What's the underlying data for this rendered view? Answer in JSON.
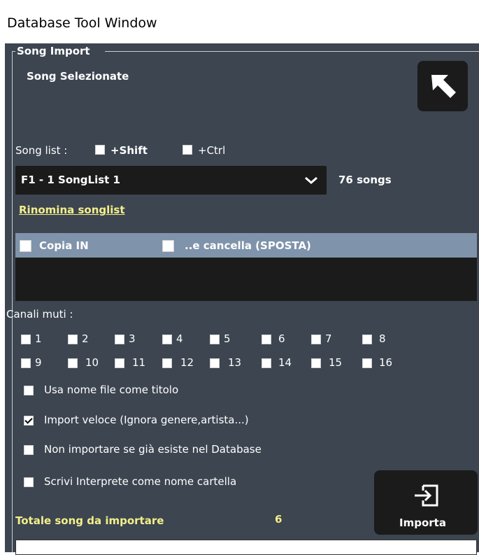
{
  "window": {
    "title": "Database Tool Window"
  },
  "group": {
    "title": "Song Import"
  },
  "selected_label": "Song Selezionate",
  "songlist": {
    "label": "Song list :",
    "shift_label": "+Shift",
    "ctrl_label": "+Ctrl",
    "shift_checked": false,
    "ctrl_checked": false,
    "selected": "F1 - 1 SongList 1",
    "count": "76 songs",
    "rename_link": "Rinomina songlist"
  },
  "copy": {
    "copia_in_label": "Copia IN",
    "copia_in_checked": false,
    "cancella_label": "..e cancella (SPOSTA)",
    "cancella_checked": false
  },
  "channels": {
    "label": "Canali muti :",
    "items": [
      "1",
      "2",
      "3",
      "4",
      "5",
      "6",
      "7",
      "8",
      "9",
      "10",
      "11",
      "12",
      "13",
      "14",
      "15",
      "16"
    ]
  },
  "options": [
    {
      "label": "Usa nome file come titolo",
      "checked": false
    },
    {
      "label": "Import veloce (Ignora genere,artista...)",
      "checked": true
    },
    {
      "label": "Non importare se già esiste nel Database",
      "checked": false
    },
    {
      "label": "Scrivi Interprete come nome cartella",
      "checked": false
    }
  ],
  "totale": {
    "label": "Totale song da importare",
    "value": "6"
  },
  "import_button": {
    "label": "Importa",
    "icon": "import-icon"
  },
  "back_button": {
    "icon": "arrow-up-left-icon"
  },
  "colors": {
    "panel_bg": "#3c4550",
    "dark_control": "#1b1b1b",
    "accent_yellow": "#f3ef8a",
    "copy_bar": "#7f93ab"
  }
}
